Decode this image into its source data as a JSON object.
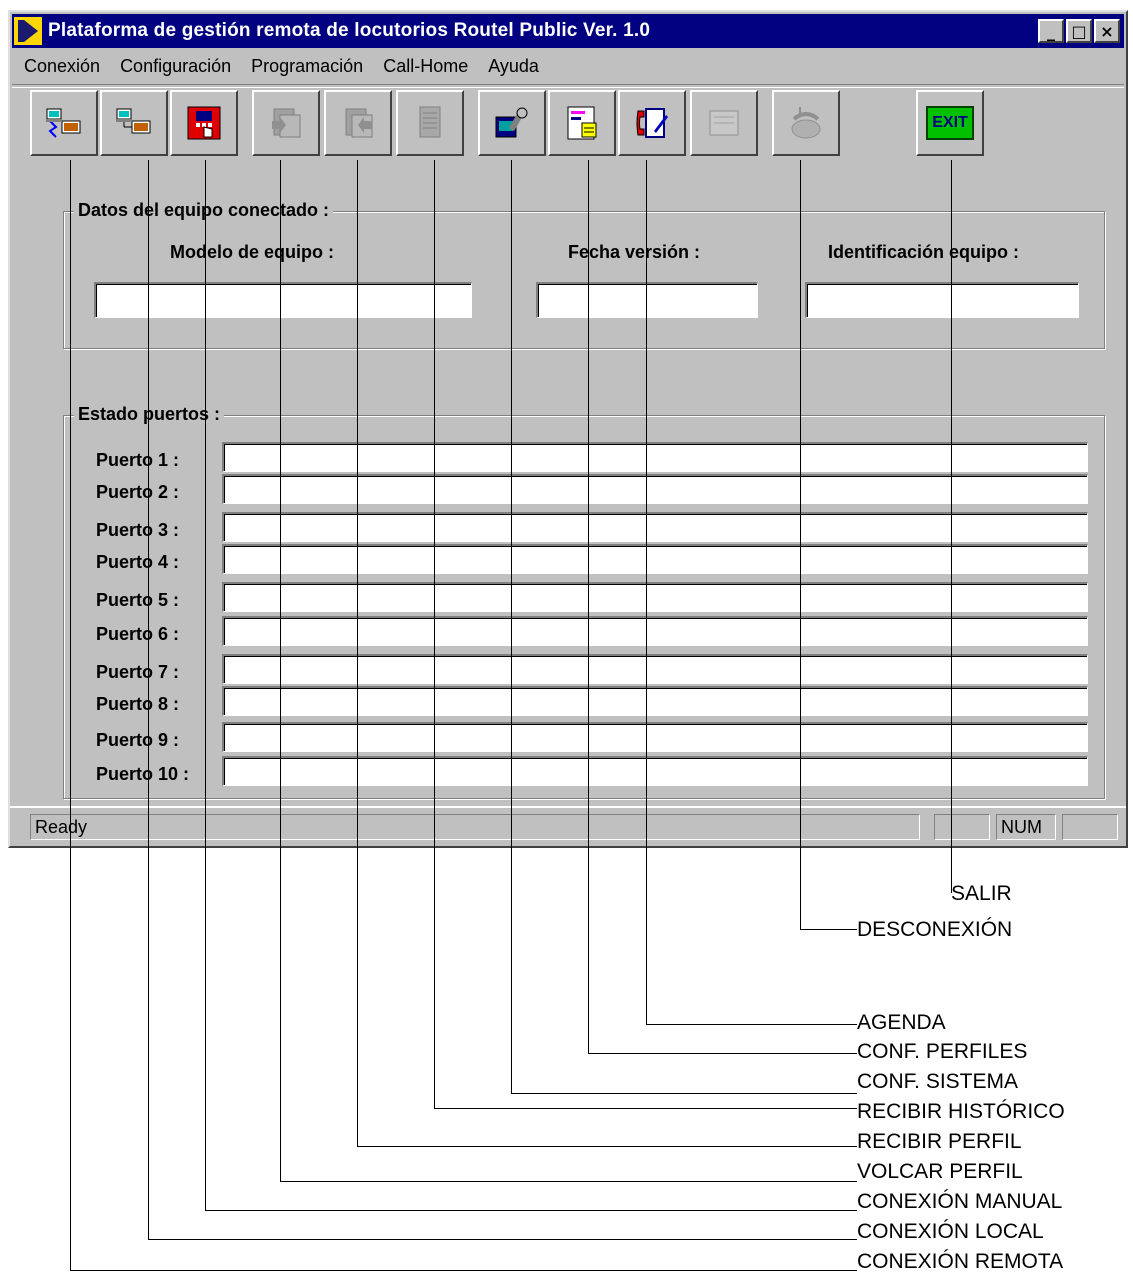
{
  "window": {
    "title": "Plataforma de gestión remota de locutorios Routel Public Ver. 1.0",
    "minimize_glyph": "_",
    "maximize_glyph": "□",
    "close_glyph": "×"
  },
  "menu": [
    {
      "label": "Conexión"
    },
    {
      "label": "Configuración"
    },
    {
      "label": "Programación"
    },
    {
      "label": "Call-Home"
    },
    {
      "label": "Ayuda"
    }
  ],
  "toolbar": {
    "buttons": [
      {
        "icon": "remote-connection-icon"
      },
      {
        "icon": "local-connection-icon"
      },
      {
        "icon": "manual-connection-icon"
      },
      {
        "icon": "send-profile-icon"
      },
      {
        "icon": "receive-profile-icon"
      },
      {
        "icon": "receive-history-icon"
      },
      {
        "icon": "system-config-icon"
      },
      {
        "icon": "profiles-config-icon"
      },
      {
        "icon": "agenda-icon"
      },
      {
        "icon": "blank-form-icon"
      },
      {
        "icon": "disconnect-icon"
      },
      {
        "icon": "exit-icon",
        "label": "EXIT"
      }
    ]
  },
  "equipo": {
    "group_title": "Datos del equipo conectado :",
    "modelo_label": "Modelo de equipo :",
    "fecha_label": "Fecha versión :",
    "ident_label": "Identificación equipo :",
    "modelo_value": "",
    "fecha_value": "",
    "ident_value": ""
  },
  "puertos": {
    "group_title": "Estado puertos :",
    "items": [
      {
        "label": "Puerto 1 :",
        "value": ""
      },
      {
        "label": "Puerto 2 :",
        "value": ""
      },
      {
        "label": "Puerto 3 :",
        "value": ""
      },
      {
        "label": "Puerto 4 :",
        "value": ""
      },
      {
        "label": "Puerto 5 :",
        "value": ""
      },
      {
        "label": "Puerto 6 :",
        "value": ""
      },
      {
        "label": "Puerto 7 :",
        "value": ""
      },
      {
        "label": "Puerto 8 :",
        "value": ""
      },
      {
        "label": "Puerto 9 :",
        "value": ""
      },
      {
        "label": "Puerto 10 :",
        "value": ""
      }
    ]
  },
  "status": {
    "text": "Ready",
    "num": "NUM"
  },
  "callouts": [
    "SALIR",
    "DESCONEXIÓN",
    "AGENDA",
    "CONF. PERFILES",
    "CONF. SISTEMA",
    "RECIBIR HISTÓRICO",
    "RECIBIR PERFIL",
    "VOLCAR PERFIL",
    "CONEXIÓN MANUAL",
    "CONEXIÓN LOCAL",
    "CONEXIÓN REMOTA"
  ]
}
